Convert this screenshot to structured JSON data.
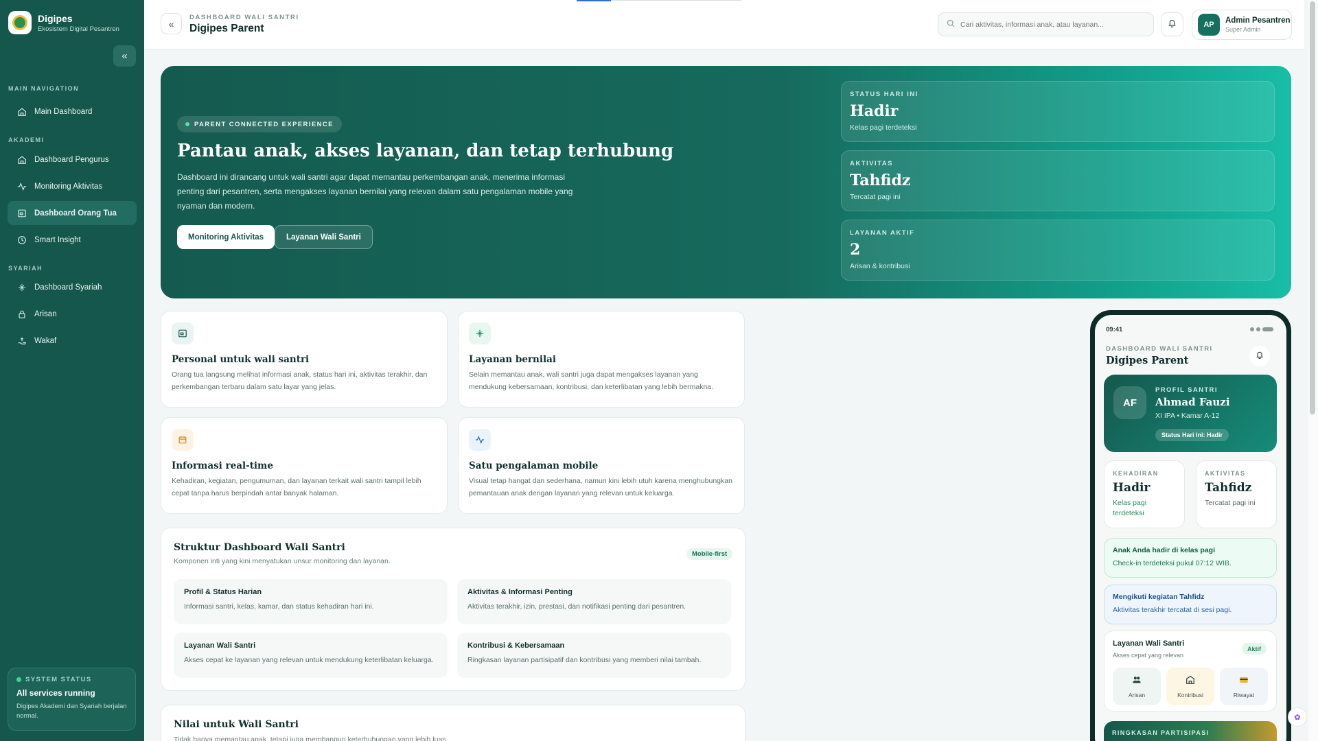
{
  "sidebar": {
    "brand_name": "Digipes",
    "brand_sub": "Ekosistem Digital Pesantren",
    "sections": {
      "main": "MAIN NAVIGATION",
      "akademi": "AKADEMI",
      "syariah": "SYARIAH"
    },
    "items": [
      {
        "label": "Main Dashboard",
        "icon": "home-icon"
      },
      {
        "label": "Dashboard Pengurus",
        "icon": "home-icon"
      },
      {
        "label": "Monitoring Aktivitas",
        "icon": "activity-icon"
      },
      {
        "label": "Dashboard Orang Tua",
        "icon": "monitor-icon",
        "active": true
      },
      {
        "label": "Smart Insight",
        "icon": "clock-icon"
      },
      {
        "label": "Dashboard Syariah",
        "icon": "sparkle-icon"
      },
      {
        "label": "Arisan",
        "icon": "lock-icon"
      },
      {
        "label": "Wakaf",
        "icon": "hand-icon"
      }
    ],
    "system": {
      "kicker": "SYSTEM STATUS",
      "title": "All services running",
      "desc": "Digipes Akademi dan Syariah berjalan normal."
    }
  },
  "header": {
    "kicker": "DASHBOARD WALI SANTRI",
    "title": "Digipes Parent",
    "search_placeholder": "Cari aktivitas, informasi anak, atau layanan...",
    "user_initials": "AP",
    "user_name": "Admin Pesantren",
    "user_role": "Super Admin"
  },
  "hero": {
    "pill": "PARENT CONNECTED EXPERIENCE",
    "title": "Pantau anak, akses layanan, dan tetap terhubung",
    "desc": "Dashboard ini dirancang untuk wali santri agar dapat memantau perkembangan anak, menerima informasi penting dari pesantren, serta mengakses layanan bernilai yang relevan dalam satu pengalaman mobile yang nyaman dan modern.",
    "btn_primary": "Monitoring Aktivitas",
    "btn_secondary": "Layanan Wali Santri",
    "stats": [
      {
        "kicker": "STATUS HARI INI",
        "value": "Hadir",
        "sub": "Kelas pagi terdeteksi"
      },
      {
        "kicker": "AKTIVITAS",
        "value": "Tahfidz",
        "sub": "Tercatat pagi ini"
      },
      {
        "kicker": "LAYANAN AKTIF",
        "value": "2",
        "sub": "Arisan & kontribusi"
      }
    ]
  },
  "features": [
    {
      "title": "Personal untuk wali santri",
      "desc": "Orang tua langsung melihat informasi anak, status hari ini, aktivitas terakhir, dan perkembangan terbaru dalam satu layar yang jelas.",
      "icon": "monitor-icon",
      "bg": "#eaf5f2",
      "fg": "#16574d"
    },
    {
      "title": "Layanan bernilai",
      "desc": "Selain memantau anak, wali santri juga dapat mengakses layanan yang mendukung kebersamaan, kontribusi, dan keterlibatan yang lebih bermakna.",
      "icon": "sparkle-icon",
      "bg": "#e8f7ef",
      "fg": "#1f8a5d"
    },
    {
      "title": "Informasi real-time",
      "desc": "Kehadiran, kegiatan, pengumuman, dan layanan terkait wali santri tampil lebih cepat tanpa harus berpindah antar banyak halaman.",
      "icon": "calendar-icon",
      "bg": "#fdf3e4",
      "fg": "#d98a1c"
    },
    {
      "title": "Satu pengalaman mobile",
      "desc": "Visual tetap hangat dan sederhana, namun kini lebih utuh karena menghubungkan pemantauan anak dengan layanan yang relevan untuk keluarga.",
      "icon": "activity-icon",
      "bg": "#eaf3fb",
      "fg": "#2a6fb0"
    }
  ],
  "struktur": {
    "title": "Struktur Dashboard Wali Santri",
    "sub": "Komponen inti yang kini menyatukan unsur monitoring dan layanan.",
    "badge": "Mobile-first",
    "items": [
      {
        "title": "Profil & Status Harian",
        "desc": "Informasi santri, kelas, kamar, dan status kehadiran hari ini."
      },
      {
        "title": "Aktivitas & Informasi Penting",
        "desc": "Aktivitas terakhir, izin, prestasi, dan notifikasi penting dari pesantren."
      },
      {
        "title": "Layanan Wali Santri",
        "desc": "Akses cepat ke layanan yang relevan untuk mendukung keterlibatan keluarga."
      },
      {
        "title": "Kontribusi & Kebersamaan",
        "desc": "Ringkasan layanan partisipatif dan kontribusi yang memberi nilai tambah."
      }
    ]
  },
  "nilai": {
    "title": "Nilai untuk Wali Santri",
    "sub": "Tidak hanya memantau anak, tetapi juga membangun keterhubungan yang lebih luas."
  },
  "phone": {
    "time": "09:41",
    "kicker": "DASHBOARD WALI SANTRI",
    "title": "Digipes Parent",
    "profile": {
      "initials": "AF",
      "kicker": "PROFIL SANTRI",
      "name": "Ahmad Fauzi",
      "info": "XI IPA • Kamar A-12",
      "status": "Status Hari Ini: Hadir"
    },
    "mini": [
      {
        "kicker": "KEHADIRAN",
        "value": "Hadir",
        "sub": "Kelas pagi terdeteksi"
      },
      {
        "kicker": "AKTIVITAS",
        "value": "Tahfidz",
        "sub": "Tercatat pagi ini"
      }
    ],
    "notes": [
      {
        "title": "Anak Anda hadir di kelas pagi",
        "desc": "Check-in terdeteksi pukul 07:12 WIB."
      },
      {
        "title": "Mengikuti kegiatan Tahfidz",
        "desc": "Aktivitas terakhir tercatat di sesi pagi."
      }
    ],
    "services": {
      "title": "Layanan Wali Santri",
      "sub": "Akses cepat yang relevan",
      "badge": "Aktif",
      "tiles": [
        {
          "label": "Arisan",
          "icon": "people-icon",
          "bg": "#eef5f3"
        },
        {
          "label": "Kontribusi",
          "icon": "building-icon",
          "bg": "#fdf6e3"
        },
        {
          "label": "Riwayat",
          "icon": "card-icon",
          "bg": "#f1f4f8"
        }
      ]
    },
    "bottom_kicker": "RINGKASAN PARTISIPASI"
  }
}
